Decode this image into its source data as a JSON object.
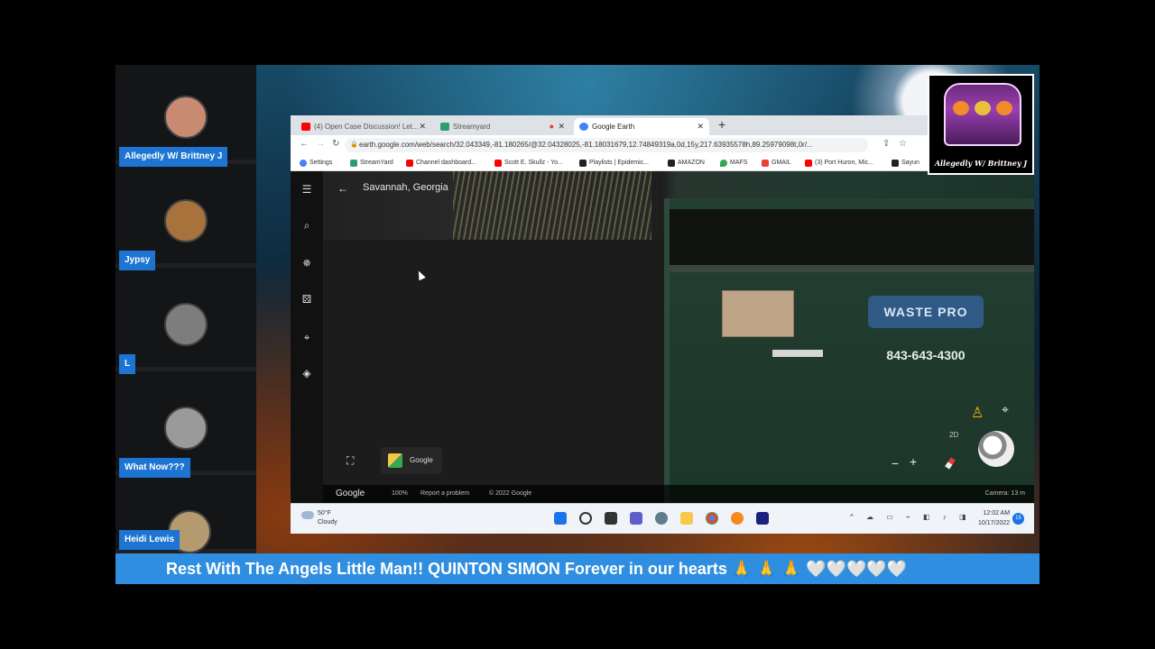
{
  "participants": [
    {
      "name": "Allegedly W/ Brittney J",
      "avatar_color": "#c98a72"
    },
    {
      "name": "Jypsy",
      "avatar_color": "#a8723d"
    },
    {
      "name": "L",
      "avatar_color": "#7d7d7d"
    },
    {
      "name": "What Now???",
      "avatar_color": "#9a9a9a"
    },
    {
      "name": "Heidi Lewis",
      "avatar_color": "#b49a6e"
    }
  ],
  "browser": {
    "tabs": [
      {
        "title": "(4) Open Case Discussion! Let...",
        "icon_color": "#ff0000",
        "active": false
      },
      {
        "title": "Streamyard",
        "icon_color": "#2e9e6e",
        "active": false
      },
      {
        "title": "Google Earth",
        "icon_color": "#4285f4",
        "active": true
      }
    ],
    "url": "earth.google.com/web/search/32.043349,-81.180265/@32.04328025,-81.18031679,12.74849319a,0d,15y,217.63935578h,89.25979098t,0r/...",
    "bookmarks": [
      {
        "label": "Settings",
        "icon_color": "#4285f4"
      },
      {
        "label": "StreamYard",
        "icon_color": "#2e9e6e"
      },
      {
        "label": "Channel dashboard...",
        "icon_color": "#ff0000"
      },
      {
        "label": "Scott E. Skullz - Yo...",
        "icon_color": "#ff0000"
      },
      {
        "label": "Playlists | Epidemic...",
        "icon_color": "#222222"
      },
      {
        "label": "AMAZON",
        "icon_color": "#222222"
      },
      {
        "label": "MAFS",
        "icon_color": "#34a853"
      },
      {
        "label": "GMAIL",
        "icon_color": "#ea4335"
      },
      {
        "label": "(3) Port Huron, Mic...",
        "icon_color": "#ff0000"
      },
      {
        "label": "Sayun",
        "icon_color": "#222222"
      }
    ]
  },
  "earth": {
    "location_title": "Savannah, Georgia",
    "sign_text": "WASTE PRO",
    "phone_text": "843-643-4300",
    "voyager_label": "Google",
    "mode_label": "2D",
    "footer": {
      "brand": "Google",
      "zoom_pct": "100%",
      "report": "Report a problem",
      "copyright": "© 2022 Google",
      "camera": "Camera: 13 m"
    }
  },
  "taskbar": {
    "weather_temp": "50°F",
    "weather_desc": "Cloudy",
    "time": "12:02 AM",
    "date": "10/17/2022",
    "notifications": "15"
  },
  "logo_text": "Allegedly W/ Brittney J",
  "ticker_text": "Rest With The Angels Little Man!! QUINTON SIMON Forever in our hearts 🙏 🙏 🙏 🤍🤍🤍🤍🤍"
}
